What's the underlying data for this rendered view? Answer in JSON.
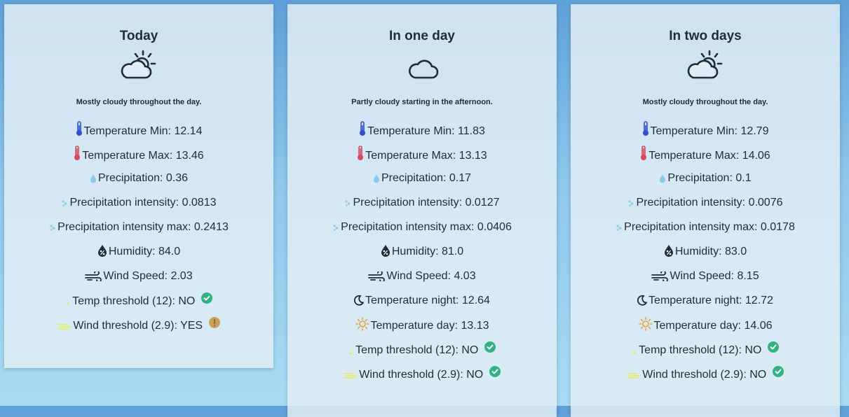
{
  "cards": [
    {
      "title": "Today",
      "icon": "partly-cloudy-day-icon",
      "summary": "Mostly cloudy throughout the day.",
      "temp_min": "Temperature Min: 12.14",
      "temp_max": "Temperature Max: 13.46",
      "precipitation": "Precipitation: 0.36",
      "precip_intensity": "Precipitation intensity: 0.0813",
      "precip_intensity_max": "Precipitation intensity max: 0.2413",
      "humidity": "Humidity: 84.0",
      "wind_speed": "Wind Speed: 2.03",
      "temp_threshold": "Temp threshold (12): NO",
      "temp_threshold_status": "ok",
      "wind_threshold": "Wind threshold (2.9): YES",
      "wind_threshold_status": "alert"
    },
    {
      "title": "In one day",
      "icon": "cloud-icon",
      "summary": "Partly cloudy starting in the afternoon.",
      "temp_min": "Temperature Min: 11.83",
      "temp_max": "Temperature Max: 13.13",
      "precipitation": "Precipitation: 0.17",
      "precip_intensity": "Precipitation intensity: 0.0127",
      "precip_intensity_max": "Precipitation intensity max: 0.0406",
      "humidity": "Humidity: 81.0",
      "wind_speed": "Wind Speed: 4.03",
      "temp_night": "Temperature night: 12.64",
      "temp_day": "Temperature day: 13.13",
      "temp_threshold": "Temp threshold (12): NO",
      "temp_threshold_status": "ok",
      "wind_threshold": "Wind threshold (2.9): NO",
      "wind_threshold_status": "ok"
    },
    {
      "title": "In two days",
      "icon": "partly-cloudy-day-icon",
      "summary": "Mostly cloudy throughout the day.",
      "temp_min": "Temperature Min: 12.79",
      "temp_max": "Temperature Max: 14.06",
      "precipitation": "Precipitation: 0.1",
      "precip_intensity": "Precipitation intensity: 0.0076",
      "precip_intensity_max": "Precipitation intensity max: 0.0178",
      "humidity": "Humidity: 83.0",
      "wind_speed": "Wind Speed: 8.15",
      "temp_night": "Temperature night: 12.72",
      "temp_day": "Temperature day: 14.06",
      "temp_threshold": "Temp threshold (12): NO",
      "temp_threshold_status": "ok",
      "wind_threshold": "Wind threshold (2.9): NO",
      "wind_threshold_status": "ok"
    }
  ],
  "colors": {
    "thermo_cold": "#2f4fd6",
    "thermo_hot": "#d9485a",
    "drop": "#8ccbe8",
    "sun": "#e8a53a",
    "threshold": "#e8ef4a",
    "ok": "#2fb384",
    "alert": "#c8a25a"
  }
}
